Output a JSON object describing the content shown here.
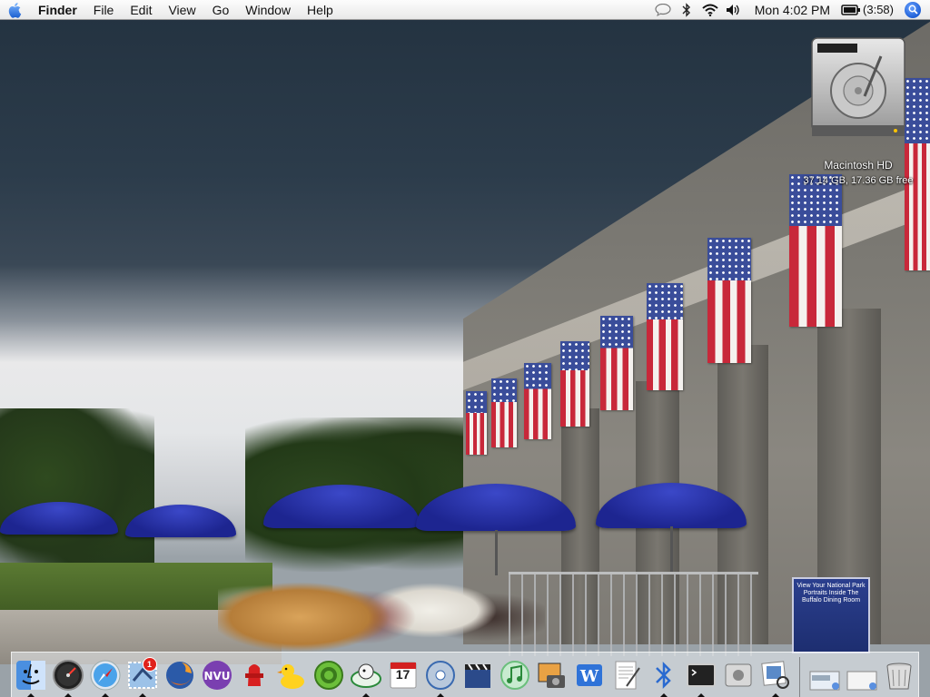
{
  "menubar": {
    "app_name": "Finder",
    "items": [
      "File",
      "Edit",
      "View",
      "Go",
      "Window",
      "Help"
    ],
    "clock": "Mon 4:02 PM",
    "battery": "(3:58)"
  },
  "desktop": {
    "disk_name": "Macintosh HD",
    "disk_info": "37.14 GB, 17.36 GB free",
    "sign_text": "View Your National Park Portraits Inside The Buffalo Dining Room"
  },
  "dock": {
    "mail_badge": "1",
    "ical_date": "17",
    "apps": [
      "finder",
      "dashboard",
      "safari",
      "mail-stamp",
      "firefox",
      "nvu",
      "fire-hydrant",
      "rubber-duck",
      "system-preferences",
      "ichat-like",
      "ical",
      "dvd-player",
      "imovie",
      "itunes",
      "iphoto",
      "word",
      "textedit",
      "bluetooth",
      "terminal",
      "apple-tool",
      "preview"
    ],
    "right": [
      "documents-stack",
      "display-stack",
      "trash"
    ]
  }
}
